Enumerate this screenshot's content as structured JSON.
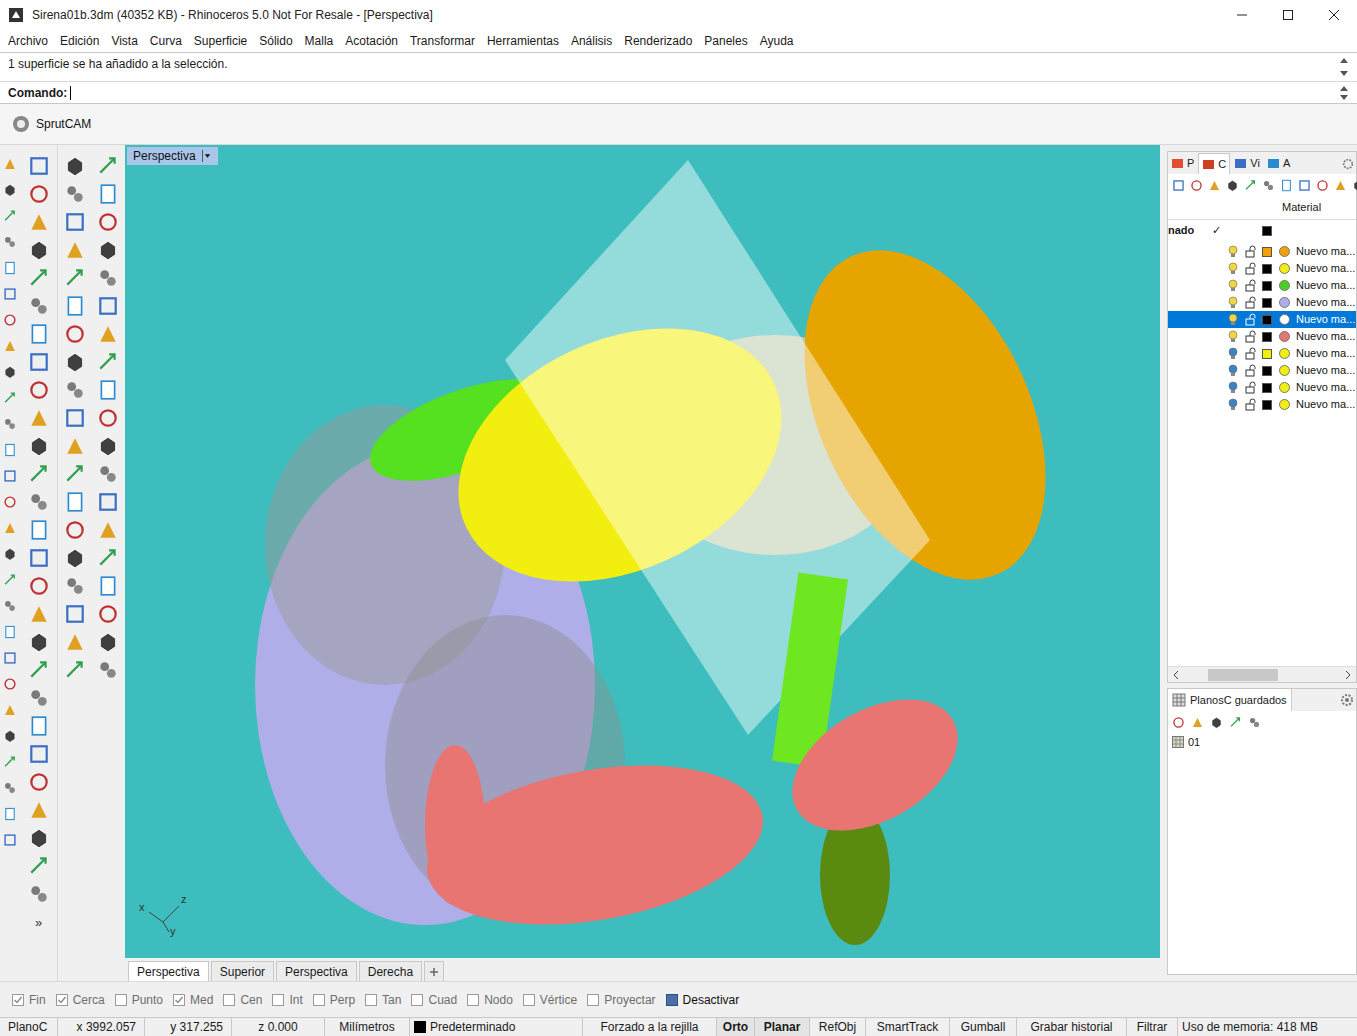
{
  "window": {
    "title": "Sirena01b.3dm (40352 KB) - Rhinoceros 5.0 Not For Resale - [Perspectiva]"
  },
  "menu": [
    "Archivo",
    "Edición",
    "Vista",
    "Curva",
    "Superficie",
    "Sólido",
    "Malla",
    "Acotación",
    "Transformar",
    "Herramientas",
    "Análisis",
    "Renderizado",
    "Paneles",
    "Ayuda"
  ],
  "command": {
    "history": "1 superficie se ha añadido a la selección.",
    "prompt": "Comando:"
  },
  "toolbar_tabs": [
    {
      "label": "SprutCAM",
      "selected": true
    }
  ],
  "left_toolbar": {
    "more": "»"
  },
  "viewport": {
    "label": "Perspectiva",
    "axes": {
      "x": "x",
      "y": "y",
      "z": "z"
    }
  },
  "viewport_tabs": [
    {
      "label": "Perspectiva",
      "selected": true
    },
    {
      "label": "Superior",
      "selected": false
    },
    {
      "label": "Perspectiva",
      "selected": false
    },
    {
      "label": "Derecha",
      "selected": false
    }
  ],
  "panel_tabs": [
    {
      "label": "P",
      "selected": false
    },
    {
      "label": "C",
      "selected": true
    },
    {
      "label": "Vi",
      "selected": false
    },
    {
      "label": "A",
      "selected": false
    }
  ],
  "layers": {
    "column": "Material",
    "default_row": {
      "name": "nado",
      "current": "✓",
      "color": "#000000"
    },
    "rows": [
      {
        "name": "Nuevo ma...",
        "on": true,
        "locked": false,
        "color": "#f5a000",
        "material_color": "#f0a000",
        "selected": false
      },
      {
        "name": "Nuevo ma...",
        "on": true,
        "locked": false,
        "color": "#000000",
        "material_color": "#f2ee10",
        "selected": false
      },
      {
        "name": "Nuevo ma...",
        "on": true,
        "locked": false,
        "color": "#000000",
        "material_color": "#4cd020",
        "selected": false
      },
      {
        "name": "Nuevo ma...",
        "on": true,
        "locked": false,
        "color": "#000000",
        "material_color": "#b0aee8",
        "selected": false
      },
      {
        "name": "Nuevo ma...",
        "on": true,
        "locked": false,
        "color": "#000000",
        "material_color": "#ffffff",
        "selected": true
      },
      {
        "name": "Nuevo ma...",
        "on": true,
        "locked": false,
        "color": "#000000",
        "material_color": "#e87572",
        "selected": false
      },
      {
        "name": "Nuevo ma...",
        "on": false,
        "locked": false,
        "color": "#f2ee10",
        "material_color": "#f2ee10",
        "selected": false
      },
      {
        "name": "Nuevo ma...",
        "on": false,
        "locked": false,
        "color": "#000000",
        "material_color": "#f2ee10",
        "selected": false
      },
      {
        "name": "Nuevo ma...",
        "on": false,
        "locked": false,
        "color": "#000000",
        "material_color": "#f2ee10",
        "selected": false
      },
      {
        "name": "Nuevo ma...",
        "on": false,
        "locked": false,
        "color": "#000000",
        "material_color": "#f2ee10",
        "selected": false
      }
    ]
  },
  "cplanes": {
    "title": "PlanosC guardados",
    "items": [
      "01"
    ]
  },
  "osnaps": [
    {
      "label": "Fin",
      "checked": true,
      "disabled": true
    },
    {
      "label": "Cerca",
      "checked": true,
      "disabled": true
    },
    {
      "label": "Punto",
      "checked": false,
      "disabled": true
    },
    {
      "label": "Med",
      "checked": true,
      "disabled": true
    },
    {
      "label": "Cen",
      "checked": false,
      "disabled": true
    },
    {
      "label": "Int",
      "checked": false,
      "disabled": true
    },
    {
      "label": "Perp",
      "checked": false,
      "disabled": true
    },
    {
      "label": "Tan",
      "checked": false,
      "disabled": true
    },
    {
      "label": "Cuad",
      "checked": false,
      "disabled": true
    },
    {
      "label": "Nodo",
      "checked": false,
      "disabled": true
    },
    {
      "label": "Vértice",
      "checked": false,
      "disabled": true
    },
    {
      "label": "Proyectar",
      "checked": false,
      "disabled": true
    },
    {
      "label": "Desactivar",
      "checked": true,
      "disabled": false
    }
  ],
  "status_bar": {
    "cplane": "PlanoC",
    "x": "x 3992.057",
    "y": "y 317.255",
    "z": "z 0.000",
    "units": "Milímetros",
    "layer": "Predeterminado",
    "layer_color": "#000000",
    "toggles": [
      {
        "label": "Forzado a la rejilla",
        "on": false
      },
      {
        "label": "Orto",
        "on": true
      },
      {
        "label": "Planar",
        "on": true
      },
      {
        "label": "RefObj",
        "on": false
      },
      {
        "label": "SmartTrack",
        "on": false
      },
      {
        "label": "Gumball",
        "on": false
      },
      {
        "label": "Grabar historial",
        "on": false
      },
      {
        "label": "Filtrar",
        "on": false
      }
    ],
    "memory": "Uso de memoria: 418 MB"
  }
}
